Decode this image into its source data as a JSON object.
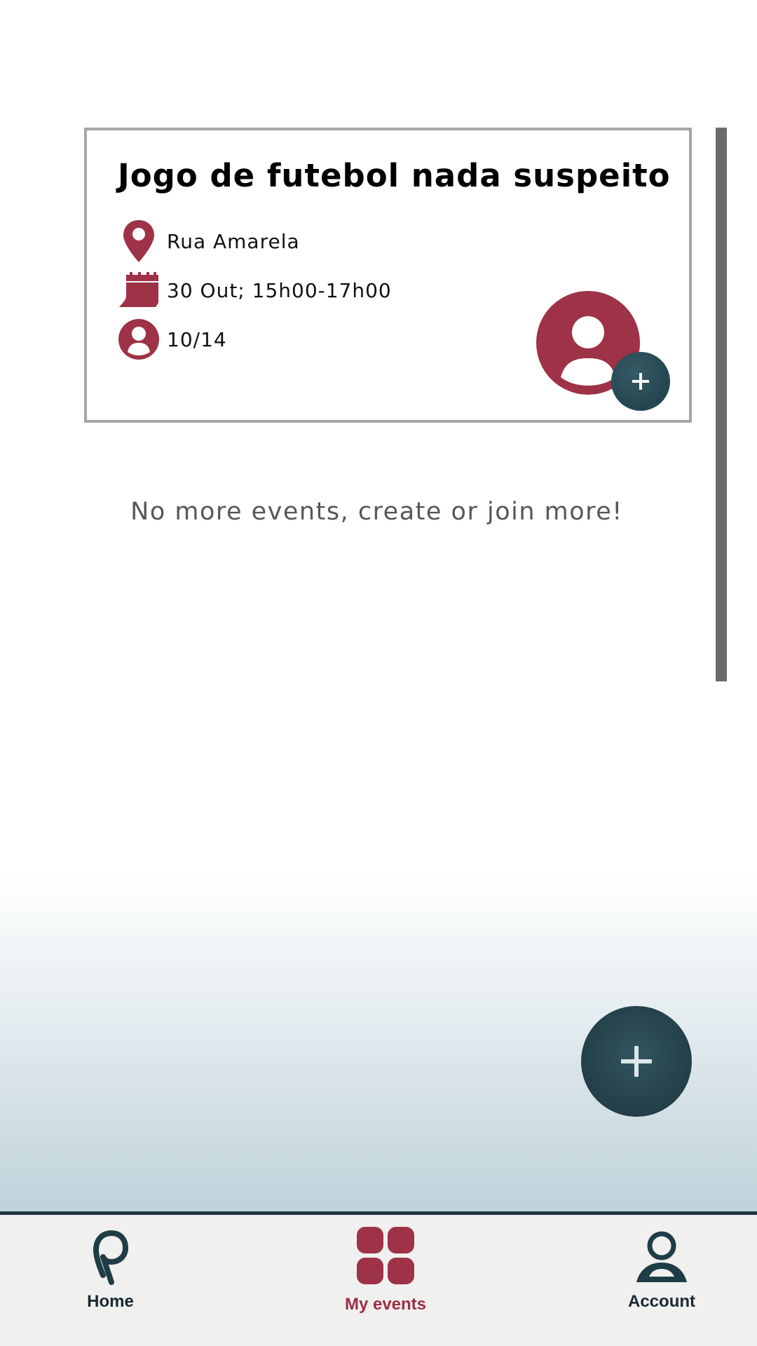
{
  "colors": {
    "accent": "#9e3247",
    "dark": "#1f3d47",
    "card_border": "#a6a6a6",
    "nav_background": "#f0f0ef"
  },
  "event": {
    "title": "Jogo de futebol nada suspeito",
    "location": "Rua Amarela",
    "datetime": "30 Out; 15h00-17h00",
    "participants": "10/14",
    "icons": {
      "location": "map-pin-icon",
      "date": "calendar-icon",
      "participants": "person-icon",
      "join": "avatar-icon",
      "join_badge": "plus-icon"
    }
  },
  "empty_message": "No more events, create or join more!",
  "fab": {
    "icon": "plus-icon"
  },
  "nav": {
    "items": [
      {
        "label": "Home",
        "icon": "home-logo-icon",
        "active": false
      },
      {
        "label": "My events",
        "icon": "grid-icon",
        "active": true
      },
      {
        "label": "Account",
        "icon": "account-icon",
        "active": false
      }
    ]
  }
}
